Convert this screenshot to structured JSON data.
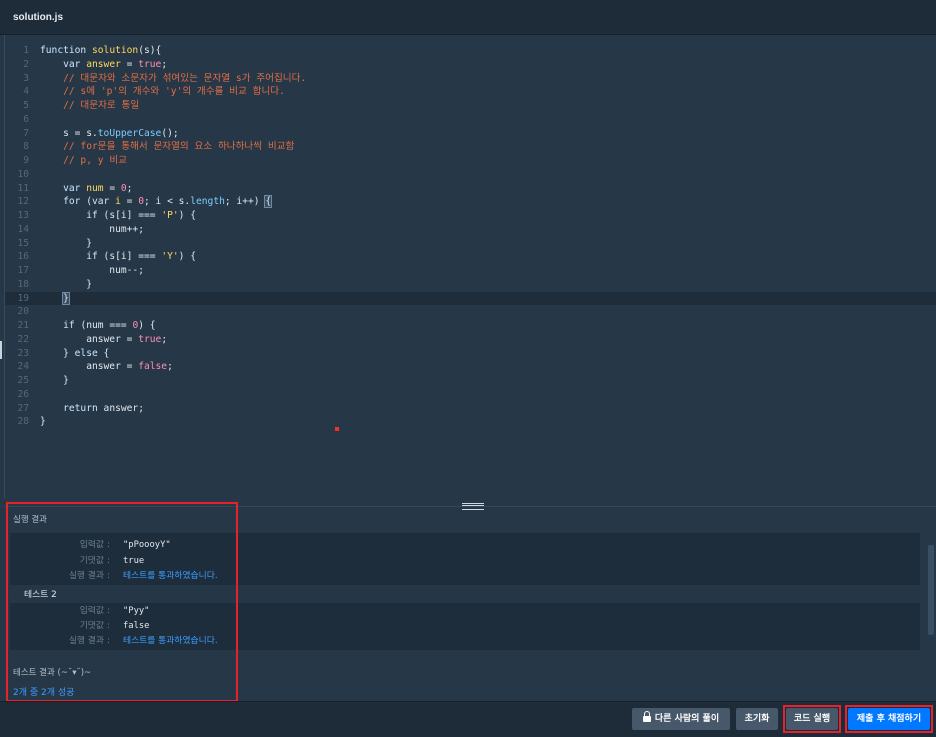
{
  "editor": {
    "tab_title": "solution.js",
    "lines": [
      {
        "n": "1",
        "html": "<span class='kw'>function</span> <span class='fn'>solution</span>(s){"
      },
      {
        "n": "2",
        "html": "    <span class='kw'>var</span> <span class='var'>answer</span> = <span class='bool'>true</span>;"
      },
      {
        "n": "3",
        "html": "    <span class='com'>// 대문자와 소문자가 섞여있는 문자열 s가 주어집니다.</span>"
      },
      {
        "n": "4",
        "html": "    <span class='com'>// s에 'p'의 개수와 'y'의 개수를 비교 합니다.</span>"
      },
      {
        "n": "5",
        "html": "    <span class='com'>// 대문자로 통일</span>"
      },
      {
        "n": "6",
        "html": ""
      },
      {
        "n": "7",
        "html": "    s = s.<span class='prop'>toUpperCase</span>();"
      },
      {
        "n": "8",
        "html": "    <span class='com'>// for문을 통해서 문자열의 요소 하나하나씩 비교함</span>"
      },
      {
        "n": "9",
        "html": "    <span class='com'>// p, y 비교</span>"
      },
      {
        "n": "10",
        "html": ""
      },
      {
        "n": "11",
        "html": "    <span class='kw'>var</span> <span class='var'>num</span> = <span class='num'>0</span>;"
      },
      {
        "n": "12",
        "html": "    <span class='kw'>for</span> (<span class='kw'>var</span> <span class='var'>i</span> = <span class='num'>0</span>; i &lt; s.<span class='prop'>length</span>; i++) <span class='brk'>{</span>"
      },
      {
        "n": "13",
        "html": "        <span class='kw'>if</span> (s[i] === <span class='str'>'P'</span>) {"
      },
      {
        "n": "14",
        "html": "            num++;"
      },
      {
        "n": "15",
        "html": "        }"
      },
      {
        "n": "16",
        "html": "        <span class='kw'>if</span> (s[i] === <span class='str'>'Y'</span>) {"
      },
      {
        "n": "17",
        "html": "            num--;"
      },
      {
        "n": "18",
        "html": "        }"
      },
      {
        "n": "19",
        "html": "    <span class='brk'>}</span>",
        "active": true
      },
      {
        "n": "20",
        "html": ""
      },
      {
        "n": "21",
        "html": "    <span class='kw'>if</span> (num === <span class='num'>0</span>) {"
      },
      {
        "n": "22",
        "html": "        answer = <span class='bool'>true</span>;"
      },
      {
        "n": "23",
        "html": "    } <span class='kw'>else</span> {"
      },
      {
        "n": "24",
        "html": "        answer = <span class='bool'>false</span>;"
      },
      {
        "n": "25",
        "html": "    }"
      },
      {
        "n": "26",
        "html": ""
      },
      {
        "n": "27",
        "html": "    <span class='kw'>return</span> answer;"
      },
      {
        "n": "28",
        "html": "}"
      }
    ]
  },
  "result": {
    "title": "실행 결과",
    "test1": {
      "input_label": "입력값",
      "input": "\"pPoooyY\"",
      "expected_label": "기댓값",
      "expected": "true",
      "result_label": "실행 결과",
      "result": "테스트를 통과하였습니다."
    },
    "test2": {
      "name": "테스트 2",
      "input_label": "입력값",
      "input": "\"Pyy\"",
      "expected_label": "기댓값",
      "expected": "false",
      "result_label": "실행 결과",
      "result": "테스트를 통과하였습니다."
    },
    "separator": ":",
    "summary_label": "테스트 결과 (~˘▾˘)~",
    "summary_value": "2개 중 2개 성공"
  },
  "footer": {
    "others_solution": "다른 사람의 풀이",
    "reset": "초기화",
    "run": "코드 실행",
    "submit": "제출 후 채점하기"
  },
  "colors": {
    "highlight": "#e8212a",
    "primary": "#0078ff",
    "background": "#263747"
  }
}
